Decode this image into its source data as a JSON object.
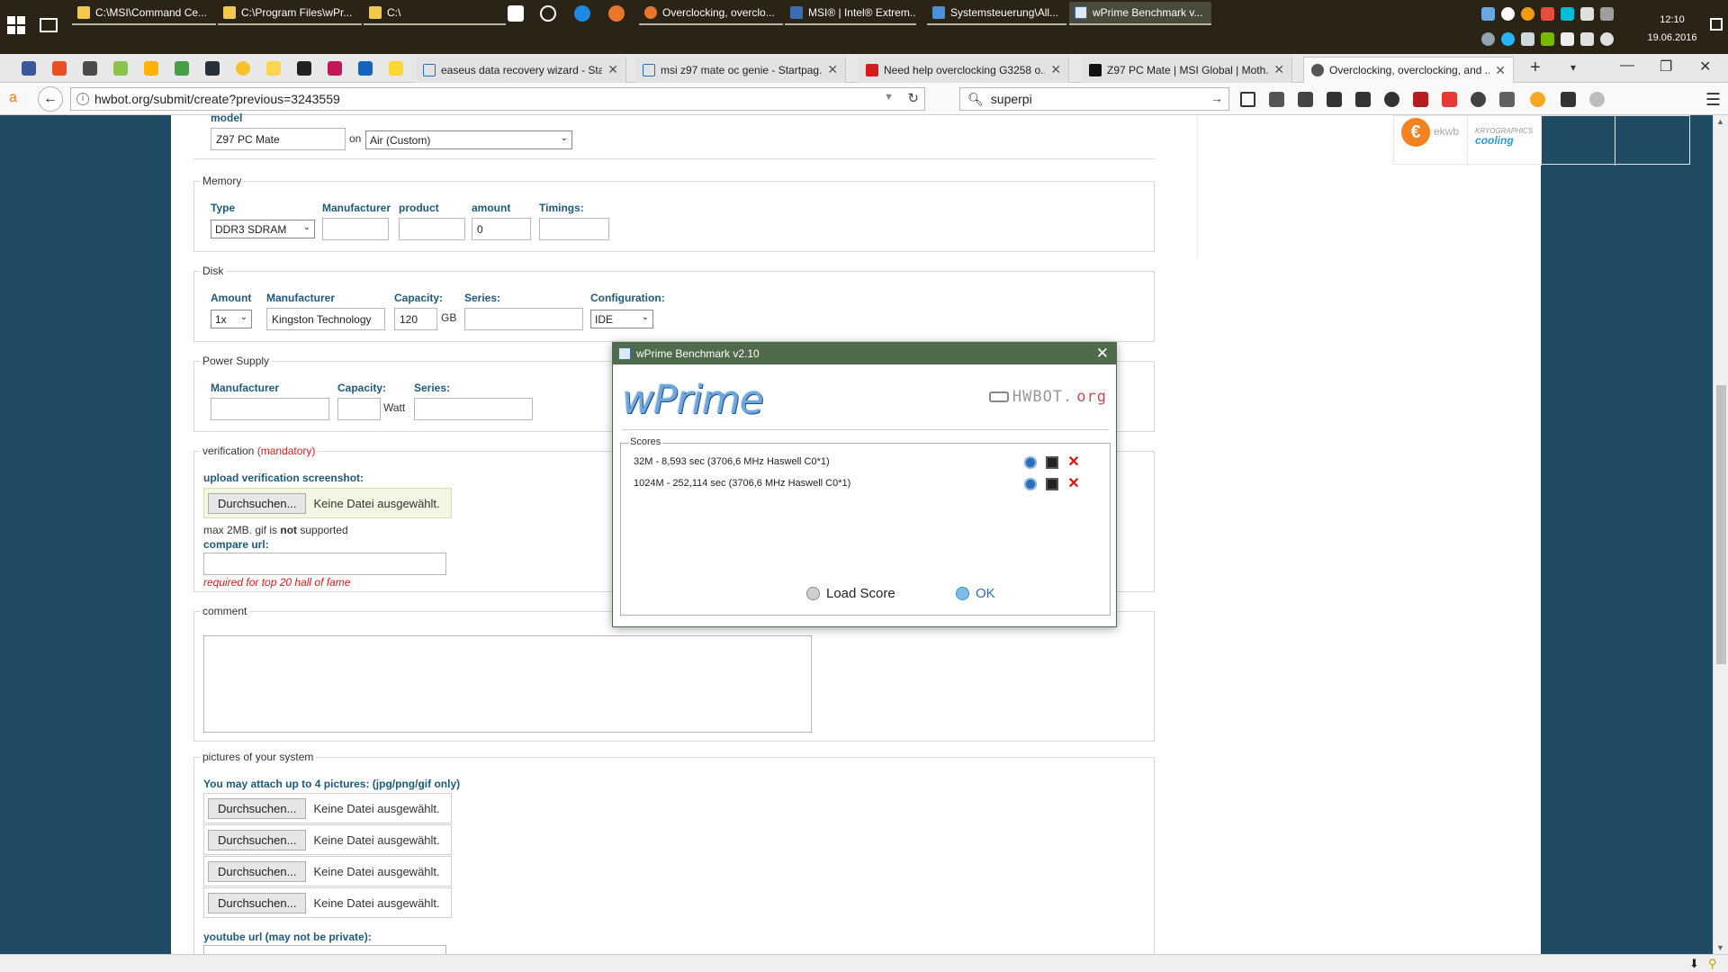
{
  "taskbar": {
    "items": [
      {
        "label": "C:\\MSI\\Command Ce...",
        "color": "#f2c94c"
      },
      {
        "label": "C:\\Program Files\\wPr...",
        "color": "#f2c94c"
      },
      {
        "label": "C:\\",
        "color": "#f2c94c"
      },
      {
        "label": "Overclocking, overclo...",
        "color": "#e8762b"
      },
      {
        "label": "MSI® | Intel® Extrem...",
        "color": "#3b6db3"
      },
      {
        "label": "Systemsteuerung\\All...",
        "color": "#4a90d9"
      },
      {
        "label": "wPrime Benchmark v...",
        "color": "#3b6db3"
      }
    ],
    "clock_time": "12:10",
    "clock_date": "19.06.2016"
  },
  "tabs": [
    {
      "title": "easeus data recovery wizard - Sta...",
      "fav": "sp",
      "color": "#2a6fb4"
    },
    {
      "title": "msi z97 mate oc genie - Startpag...",
      "fav": "sp",
      "color": "#2a6fb4"
    },
    {
      "title": "Need help overclocking G3258 o...",
      "fav": "T",
      "color": "#d41c1c"
    },
    {
      "title": "Z97 PC Mate | MSI Global | Moth...",
      "fav": "m",
      "color": "#111111"
    },
    {
      "title": "Overclocking, overclocking, and ...",
      "fav": "hw",
      "color": "#555555"
    }
  ],
  "nav": {
    "url": "hwbot.org/submit/create?previous=3243559",
    "search": "superpi"
  },
  "form": {
    "model": {
      "legend": "model",
      "value": "Z97 PC Mate",
      "on": "on",
      "cooling": "Air (Custom)"
    },
    "memory": {
      "legend": "Memory",
      "type_label": "Type",
      "type_value": "DDR3 SDRAM",
      "manufacturer_label": "Manufacturer",
      "product_label": "product",
      "amount_label": "amount",
      "amount_value": "0",
      "timings_label": "Timings:"
    },
    "disk": {
      "legend": "Disk",
      "amount_label": "Amount",
      "amount_value": "1x",
      "manufacturer_label": "Manufacturer",
      "manufacturer_value": "Kingston Technology",
      "capacity_label": "Capacity:",
      "capacity_value": "120",
      "capacity_unit": "GB",
      "series_label": "Series:",
      "config_label": "Configuration:",
      "config_value": "IDE"
    },
    "psu": {
      "legend": "Power Supply",
      "manufacturer_label": "Manufacturer",
      "capacity_label": "Capacity:",
      "capacity_unit": "Watt",
      "series_label": "Series:"
    },
    "verification": {
      "legend": "verification",
      "mandatory": "(mandatory)",
      "upload_label": "upload verification screenshot:",
      "browse": "Durchsuchen...",
      "no_file": "Keine Datei ausgewählt.",
      "note_prefix": "max 2MB. gif is ",
      "note_bold": "not",
      "note_suffix": " supported",
      "compare_label": "compare url:",
      "hof_note": "required for top 20 hall of fame"
    },
    "comment": {
      "legend": "comment"
    },
    "pictures": {
      "legend": "pictures of your system",
      "attach_label": "You may attach up to 4 pictures: (jpg/png/gif only)",
      "browse": "Durchsuchen...",
      "no_file": "Keine Datei ausgewählt.",
      "youtube_label": "youtube url (may not be private):"
    }
  },
  "sponsors": {
    "ekwb": "ekwb",
    "kc_top": "KRYOGRAPHICS",
    "kc_bottom": "cooling"
  },
  "dialog": {
    "title": "wPrime Benchmark v2.10",
    "logo": "wPrime",
    "hwbot_text": "HWBOT.",
    "hwbot_org": "org",
    "scores_caption": "Scores",
    "scores": [
      "32M - 8,593 sec (3706,6 MHz Haswell C0*1)",
      "1024M - 252,114 sec (3706,6 MHz Haswell C0*1)"
    ],
    "load_score": "Load Score",
    "ok": "OK"
  }
}
